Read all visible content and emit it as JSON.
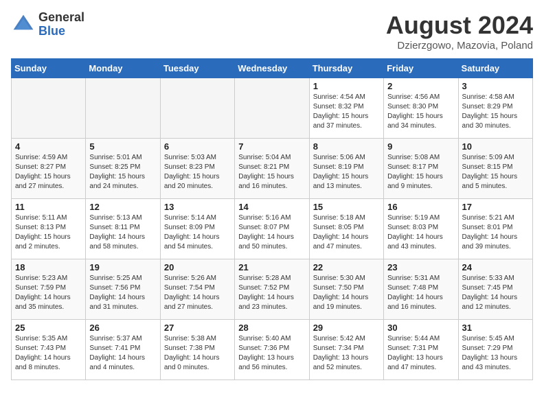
{
  "logo": {
    "general": "General",
    "blue": "Blue"
  },
  "title": "August 2024",
  "location": "Dzierzgowo, Mazovia, Poland",
  "days_header": [
    "Sunday",
    "Monday",
    "Tuesday",
    "Wednesday",
    "Thursday",
    "Friday",
    "Saturday"
  ],
  "weeks": [
    [
      {
        "day": "",
        "info": ""
      },
      {
        "day": "",
        "info": ""
      },
      {
        "day": "",
        "info": ""
      },
      {
        "day": "",
        "info": ""
      },
      {
        "day": "1",
        "info": "Sunrise: 4:54 AM\nSunset: 8:32 PM\nDaylight: 15 hours\nand 37 minutes."
      },
      {
        "day": "2",
        "info": "Sunrise: 4:56 AM\nSunset: 8:30 PM\nDaylight: 15 hours\nand 34 minutes."
      },
      {
        "day": "3",
        "info": "Sunrise: 4:58 AM\nSunset: 8:29 PM\nDaylight: 15 hours\nand 30 minutes."
      }
    ],
    [
      {
        "day": "4",
        "info": "Sunrise: 4:59 AM\nSunset: 8:27 PM\nDaylight: 15 hours\nand 27 minutes."
      },
      {
        "day": "5",
        "info": "Sunrise: 5:01 AM\nSunset: 8:25 PM\nDaylight: 15 hours\nand 24 minutes."
      },
      {
        "day": "6",
        "info": "Sunrise: 5:03 AM\nSunset: 8:23 PM\nDaylight: 15 hours\nand 20 minutes."
      },
      {
        "day": "7",
        "info": "Sunrise: 5:04 AM\nSunset: 8:21 PM\nDaylight: 15 hours\nand 16 minutes."
      },
      {
        "day": "8",
        "info": "Sunrise: 5:06 AM\nSunset: 8:19 PM\nDaylight: 15 hours\nand 13 minutes."
      },
      {
        "day": "9",
        "info": "Sunrise: 5:08 AM\nSunset: 8:17 PM\nDaylight: 15 hours\nand 9 minutes."
      },
      {
        "day": "10",
        "info": "Sunrise: 5:09 AM\nSunset: 8:15 PM\nDaylight: 15 hours\nand 5 minutes."
      }
    ],
    [
      {
        "day": "11",
        "info": "Sunrise: 5:11 AM\nSunset: 8:13 PM\nDaylight: 15 hours\nand 2 minutes."
      },
      {
        "day": "12",
        "info": "Sunrise: 5:13 AM\nSunset: 8:11 PM\nDaylight: 14 hours\nand 58 minutes."
      },
      {
        "day": "13",
        "info": "Sunrise: 5:14 AM\nSunset: 8:09 PM\nDaylight: 14 hours\nand 54 minutes."
      },
      {
        "day": "14",
        "info": "Sunrise: 5:16 AM\nSunset: 8:07 PM\nDaylight: 14 hours\nand 50 minutes."
      },
      {
        "day": "15",
        "info": "Sunrise: 5:18 AM\nSunset: 8:05 PM\nDaylight: 14 hours\nand 47 minutes."
      },
      {
        "day": "16",
        "info": "Sunrise: 5:19 AM\nSunset: 8:03 PM\nDaylight: 14 hours\nand 43 minutes."
      },
      {
        "day": "17",
        "info": "Sunrise: 5:21 AM\nSunset: 8:01 PM\nDaylight: 14 hours\nand 39 minutes."
      }
    ],
    [
      {
        "day": "18",
        "info": "Sunrise: 5:23 AM\nSunset: 7:59 PM\nDaylight: 14 hours\nand 35 minutes."
      },
      {
        "day": "19",
        "info": "Sunrise: 5:25 AM\nSunset: 7:56 PM\nDaylight: 14 hours\nand 31 minutes."
      },
      {
        "day": "20",
        "info": "Sunrise: 5:26 AM\nSunset: 7:54 PM\nDaylight: 14 hours\nand 27 minutes."
      },
      {
        "day": "21",
        "info": "Sunrise: 5:28 AM\nSunset: 7:52 PM\nDaylight: 14 hours\nand 23 minutes."
      },
      {
        "day": "22",
        "info": "Sunrise: 5:30 AM\nSunset: 7:50 PM\nDaylight: 14 hours\nand 19 minutes."
      },
      {
        "day": "23",
        "info": "Sunrise: 5:31 AM\nSunset: 7:48 PM\nDaylight: 14 hours\nand 16 minutes."
      },
      {
        "day": "24",
        "info": "Sunrise: 5:33 AM\nSunset: 7:45 PM\nDaylight: 14 hours\nand 12 minutes."
      }
    ],
    [
      {
        "day": "25",
        "info": "Sunrise: 5:35 AM\nSunset: 7:43 PM\nDaylight: 14 hours\nand 8 minutes."
      },
      {
        "day": "26",
        "info": "Sunrise: 5:37 AM\nSunset: 7:41 PM\nDaylight: 14 hours\nand 4 minutes."
      },
      {
        "day": "27",
        "info": "Sunrise: 5:38 AM\nSunset: 7:38 PM\nDaylight: 14 hours\nand 0 minutes."
      },
      {
        "day": "28",
        "info": "Sunrise: 5:40 AM\nSunset: 7:36 PM\nDaylight: 13 hours\nand 56 minutes."
      },
      {
        "day": "29",
        "info": "Sunrise: 5:42 AM\nSunset: 7:34 PM\nDaylight: 13 hours\nand 52 minutes."
      },
      {
        "day": "30",
        "info": "Sunrise: 5:44 AM\nSunset: 7:31 PM\nDaylight: 13 hours\nand 47 minutes."
      },
      {
        "day": "31",
        "info": "Sunrise: 5:45 AM\nSunset: 7:29 PM\nDaylight: 13 hours\nand 43 minutes."
      }
    ]
  ]
}
